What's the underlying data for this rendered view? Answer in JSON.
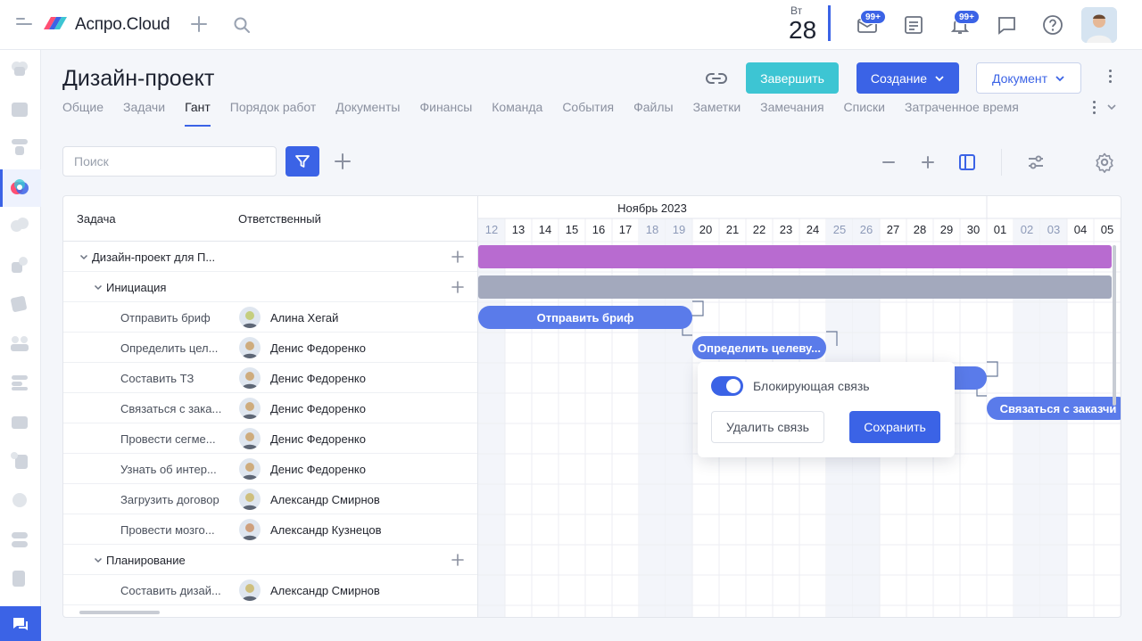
{
  "app": {
    "brand": "Аспро.Cloud"
  },
  "topbar": {
    "day_of_week": "Вт",
    "day_number": "28",
    "mail_badge": "99+",
    "notifications_badge": "99+"
  },
  "page": {
    "title": "Дизайн-проект"
  },
  "actions": {
    "finish_label": "Завершить",
    "create_label": "Создание",
    "document_label": "Документ"
  },
  "tabs": [
    {
      "label": "Общие"
    },
    {
      "label": "Задачи"
    },
    {
      "label": "Гант",
      "active": true
    },
    {
      "label": "Порядок работ"
    },
    {
      "label": "Документы"
    },
    {
      "label": "Финансы"
    },
    {
      "label": "Команда"
    },
    {
      "label": "События"
    },
    {
      "label": "Файлы"
    },
    {
      "label": "Заметки"
    },
    {
      "label": "Замечания"
    },
    {
      "label": "Списки"
    },
    {
      "label": "Затраченное время"
    }
  ],
  "search": {
    "placeholder": "Поиск",
    "value": ""
  },
  "grid": {
    "col_task": "Задача",
    "col_assignee": "Ответственный",
    "rows": [
      {
        "name": "Дизайн-проект для П...",
        "level": 0,
        "group": true,
        "assignee": ""
      },
      {
        "name": "Инициация",
        "level": 1,
        "group": true,
        "assignee": ""
      },
      {
        "name": "Отправить бриф",
        "level": 2,
        "group": false,
        "assignee": "Алина Хегай"
      },
      {
        "name": "Определить цел...",
        "level": 2,
        "group": false,
        "assignee": "Денис Федоренко"
      },
      {
        "name": "Составить ТЗ",
        "level": 2,
        "group": false,
        "assignee": "Денис Федоренко"
      },
      {
        "name": "Связаться с зака...",
        "level": 2,
        "group": false,
        "assignee": "Денис Федоренко"
      },
      {
        "name": "Провести сегме...",
        "level": 2,
        "group": false,
        "assignee": "Денис Федоренко"
      },
      {
        "name": "Узнать об интер...",
        "level": 2,
        "group": false,
        "assignee": "Денис Федоренко"
      },
      {
        "name": "Загрузить договор",
        "level": 2,
        "group": false,
        "assignee": "Александр Смирнов"
      },
      {
        "name": "Провести мозго...",
        "level": 2,
        "group": false,
        "assignee": "Александр Кузнецов"
      },
      {
        "name": "Планирование",
        "level": 1,
        "group": true,
        "assignee": ""
      },
      {
        "name": "Составить дизай...",
        "level": 2,
        "group": false,
        "assignee": "Александр Смирнов"
      }
    ]
  },
  "timeline": {
    "month": "Ноябрь 2023",
    "days": [
      {
        "d": "12",
        "we": true
      },
      {
        "d": "13"
      },
      {
        "d": "14"
      },
      {
        "d": "15"
      },
      {
        "d": "16"
      },
      {
        "d": "17"
      },
      {
        "d": "18",
        "we": true
      },
      {
        "d": "19",
        "we": true
      },
      {
        "d": "20"
      },
      {
        "d": "21"
      },
      {
        "d": "22"
      },
      {
        "d": "23"
      },
      {
        "d": "24"
      },
      {
        "d": "25",
        "we": true
      },
      {
        "d": "26",
        "we": true
      },
      {
        "d": "27"
      },
      {
        "d": "28"
      },
      {
        "d": "29"
      },
      {
        "d": "30"
      },
      {
        "d": "01"
      },
      {
        "d": "02",
        "we": true
      },
      {
        "d": "03",
        "we": true
      },
      {
        "d": "04"
      },
      {
        "d": "05"
      }
    ],
    "bars": [
      {
        "row": 0,
        "label": "",
        "kind": "summary",
        "color": "#b86bd0"
      },
      {
        "row": 1,
        "label": "",
        "kind": "summary",
        "color": "#a3a9bd"
      },
      {
        "row": 2,
        "label": "Отправить бриф",
        "kind": "task",
        "color": "#5a7bea"
      },
      {
        "row": 3,
        "label": "Определить целеву...",
        "kind": "task",
        "color": "#5a7bea"
      },
      {
        "row": 4,
        "label": "",
        "kind": "task",
        "color": "#5a7bea"
      },
      {
        "row": 5,
        "label": "Связаться с заказчи",
        "kind": "task",
        "color": "#5a7bea"
      }
    ]
  },
  "popover": {
    "toggle_label": "Блокирующая связь",
    "blocking": true,
    "delete_label": "Удалить связь",
    "save_label": "Сохранить"
  },
  "colors": {
    "accent": "#3b63e6",
    "finish": "#3dc5d3",
    "project_bar": "#b86bd0",
    "phase_bar": "#a3a9bd",
    "task_bar": "#5a7bea"
  }
}
